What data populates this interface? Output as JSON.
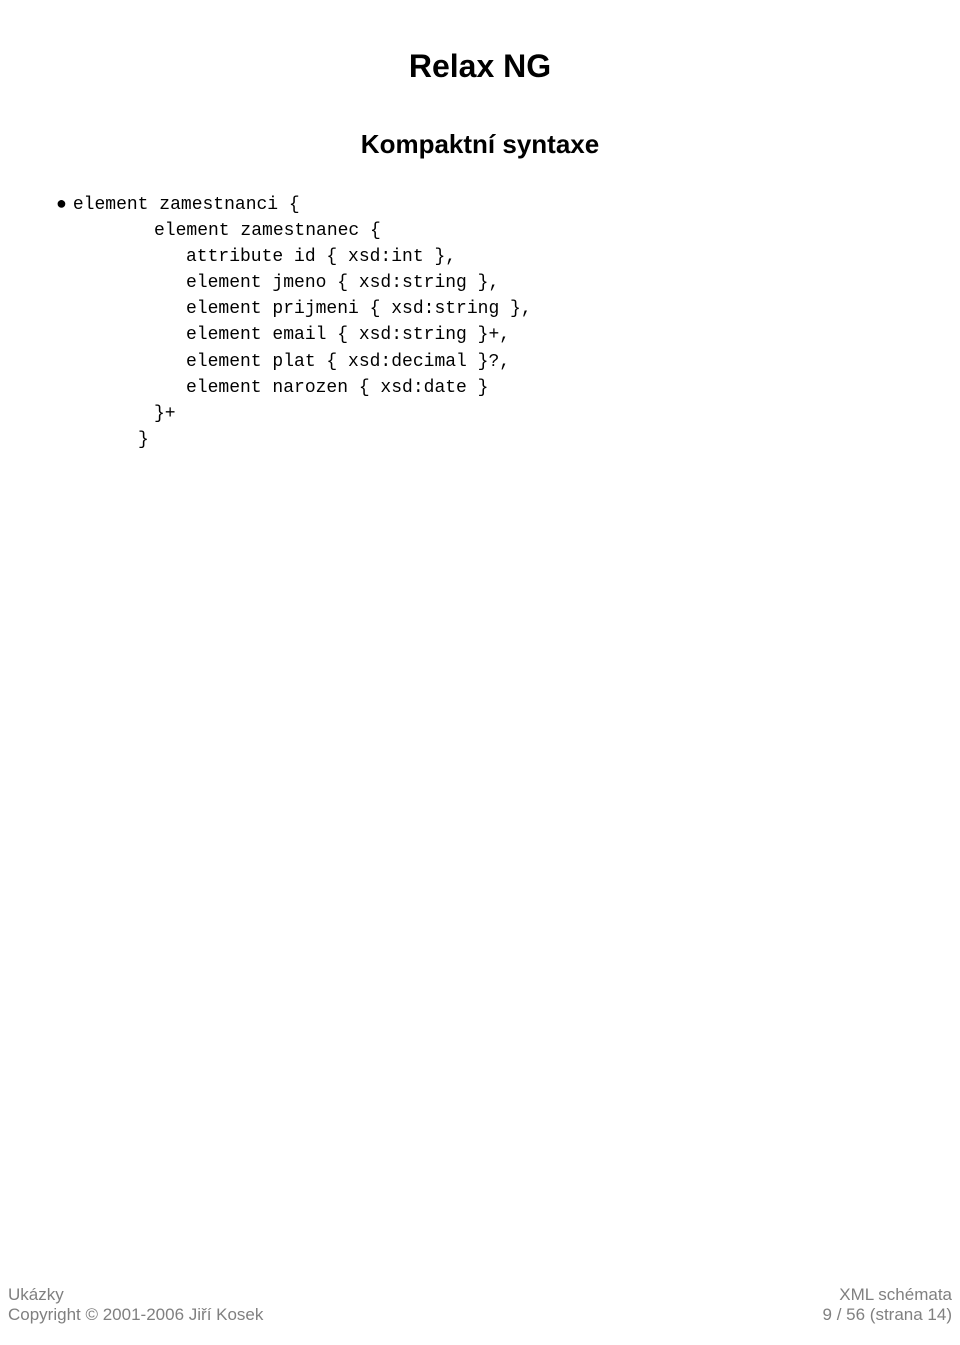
{
  "title": "Relax NG",
  "subtitle": "Kompaktní syntaxe",
  "bullet_dot": "●",
  "code": {
    "l0": "element zamestnanci {",
    "l1": "element zamestnanec {",
    "l2": "attribute id { xsd:int },",
    "l3": "element jmeno { xsd:string },",
    "l4": "element prijmeni { xsd:string },",
    "l5": "element email { xsd:string }+,",
    "l6": "element plat { xsd:decimal }?,",
    "l7": "element narozen { xsd:date }",
    "l8": "}+",
    "l9": "}"
  },
  "footer": {
    "left_line1": "Ukázky",
    "left_line2": "Copyright © 2001-2006 Jiří Kosek",
    "right_line1": "XML schémata",
    "right_line2": "9 / 56  (strana 14)"
  }
}
